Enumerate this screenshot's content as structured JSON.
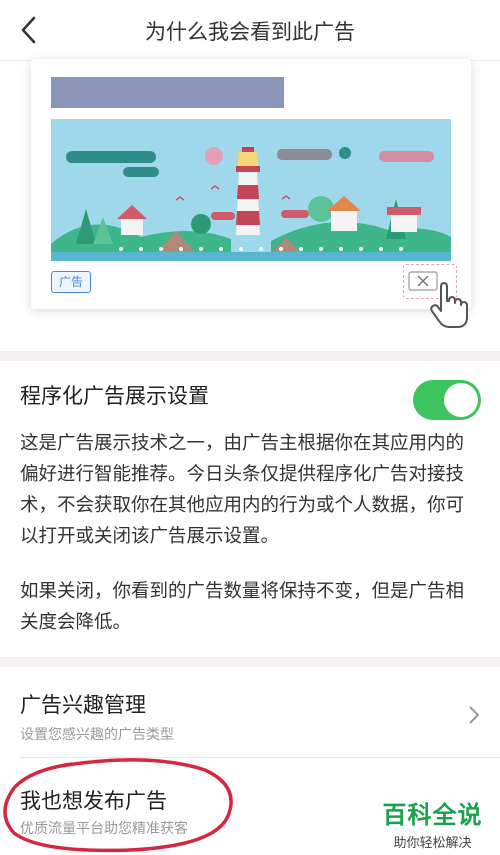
{
  "header": {
    "title": "为什么我会看到此广告"
  },
  "illustration": {
    "ad_tag": "广告",
    "colors": {
      "banner": "#8a95b8",
      "sky": "#9fd8ea",
      "lighthouse_red": "#c34657",
      "grass": "#3eb58a",
      "water": "#57b7cf"
    }
  },
  "programmatic": {
    "title": "程序化广告展示设置",
    "toggle_on": true,
    "desc1": "这是广告展示技术之一，由广告主根据你在其应用内的偏好进行智能推荐。今日头条仅提供程序化广告对接技术，不会获取你在其他应用内的行为或个人数据，你可以打开或关闭该广告展示设置。",
    "desc2": "如果关闭，你看到的广告数量将保持不变，但是广告相关度会降低。"
  },
  "interest": {
    "title": "广告兴趣管理",
    "subtitle": "设置您感兴趣的广告类型"
  },
  "publish": {
    "title": "我也想发布广告",
    "subtitle": "优质流量平台助您精准获客"
  },
  "watermark": {
    "main": "百科全说",
    "sub": "助你轻松解决"
  }
}
